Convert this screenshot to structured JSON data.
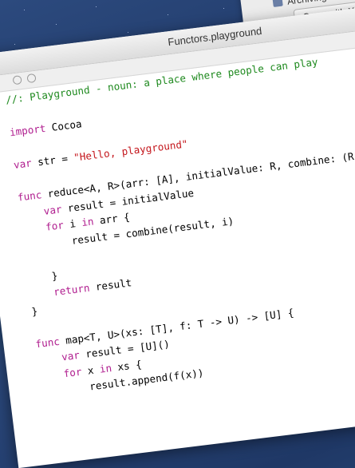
{
  "background_window": {
    "title": "Archiving",
    "open_button": "Open with X"
  },
  "window": {
    "title": "Functors.playground"
  },
  "code": {
    "lines": [
      [
        {
          "t": "//: Playground - noun: a place where people can play",
          "c": "cm"
        }
      ],
      [],
      [
        {
          "t": "import",
          "c": "kw"
        },
        {
          "t": " Cocoa",
          "c": "pl"
        }
      ],
      [],
      [
        {
          "t": "var",
          "c": "kw"
        },
        {
          "t": " str = ",
          "c": "pl"
        },
        {
          "t": "\"Hello, playground\"",
          "c": "st"
        }
      ],
      [],
      [
        {
          "t": "func",
          "c": "kw"
        },
        {
          "t": " reduce<A, R>(arr: [A], initialValue: R, combine: (R, A)",
          "c": "pl"
        }
      ],
      [
        {
          "t": "    ",
          "c": "pl"
        },
        {
          "t": "var",
          "c": "kw"
        },
        {
          "t": " result = initialValue",
          "c": "pl"
        }
      ],
      [
        {
          "t": "    ",
          "c": "pl"
        },
        {
          "t": "for",
          "c": "kw"
        },
        {
          "t": " i ",
          "c": "pl"
        },
        {
          "t": "in",
          "c": "kw"
        },
        {
          "t": " arr {",
          "c": "pl"
        }
      ],
      [
        {
          "t": "        result = combine(result, i)",
          "c": "pl"
        }
      ],
      [],
      [
        {
          "t": "    }",
          "c": "pl"
        }
      ],
      [
        {
          "t": "    ",
          "c": "pl"
        },
        {
          "t": "return",
          "c": "kw"
        },
        {
          "t": " result",
          "c": "pl"
        }
      ],
      [
        {
          "t": "}",
          "c": "pl"
        }
      ],
      [],
      [
        {
          "t": "func",
          "c": "kw"
        },
        {
          "t": " map<T, U>(xs: [T], f: T -> U) -> [U] {",
          "c": "pl"
        }
      ],
      [
        {
          "t": "    ",
          "c": "pl"
        },
        {
          "t": "var",
          "c": "kw"
        },
        {
          "t": " result = [U]()",
          "c": "pl"
        }
      ],
      [
        {
          "t": "    ",
          "c": "pl"
        },
        {
          "t": "for",
          "c": "kw"
        },
        {
          "t": " x ",
          "c": "pl"
        },
        {
          "t": "in",
          "c": "kw"
        },
        {
          "t": " xs {",
          "c": "pl"
        }
      ],
      [
        {
          "t": "        result.append(f(x))",
          "c": "pl"
        }
      ]
    ]
  },
  "colors": {
    "comment": "#1f8a1f",
    "keyword": "#b01e8f",
    "string": "#c4161c",
    "desktop": "#1f3866"
  }
}
